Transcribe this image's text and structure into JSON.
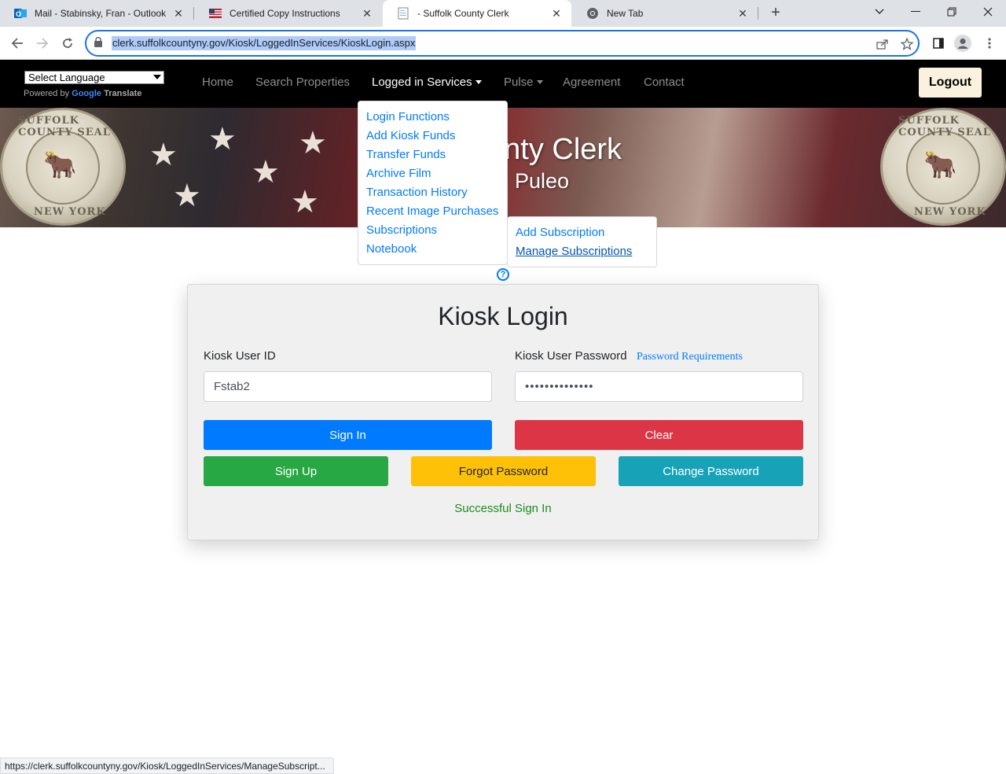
{
  "browser": {
    "tabs": [
      {
        "title": "Mail - Stabinsky, Fran - Outlook",
        "icon": "outlook-icon"
      },
      {
        "title": "Certified Copy Instructions",
        "icon": "us-flag-icon"
      },
      {
        "title": "- Suffolk County Clerk",
        "icon": "document-icon"
      },
      {
        "title": "New Tab",
        "icon": "chrome-icon"
      }
    ],
    "active_tab": 2,
    "url": "clerk.suffolkcountyny.gov/Kiosk/LoggedInServices/KioskLogin.aspx",
    "status_url": "https://clerk.suffolkcountyny.gov/Kiosk/LoggedInServices/ManageSubscript..."
  },
  "site_nav": {
    "language_select": "Select Language",
    "powered_by": "Powered by",
    "google": "Google",
    "translate": "Translate",
    "links": [
      {
        "label": "Home"
      },
      {
        "label": "Search Properties"
      },
      {
        "label": "Logged in Services"
      },
      {
        "label": "Pulse"
      },
      {
        "label": "Agreement"
      },
      {
        "label": "Contact"
      }
    ],
    "logout": "Logout"
  },
  "banner": {
    "title": "unty Clerk",
    "subtitle": "Puleo",
    "seal_top": "SUFFOLK COUNTY SEAL",
    "seal_bottom": "NEW YORK"
  },
  "logged_in_menu": [
    "Login Functions",
    "Add Kiosk Funds",
    "Transfer Funds",
    "Archive Film",
    "Transaction History",
    "Recent Image Purchases",
    "Subscriptions",
    "Notebook"
  ],
  "subscriptions_menu": [
    "Add Subscription",
    "Manage Subscriptions"
  ],
  "login": {
    "title": "Kiosk Login",
    "user_id_label": "Kiosk User ID",
    "user_id_value": "Fstab2",
    "password_label": "Kiosk User Password",
    "password_requirements": "Password Requirements",
    "password_value": "••••••••••••••",
    "sign_in": "Sign In",
    "clear": "Clear",
    "sign_up": "Sign Up",
    "forgot_password": "Forgot Password",
    "change_password": "Change Password",
    "status": "Successful Sign In"
  },
  "colors": {
    "primary": "#007bff",
    "danger": "#dc3545",
    "success": "#28a745",
    "warning": "#ffc107",
    "info": "#17a2b8"
  }
}
